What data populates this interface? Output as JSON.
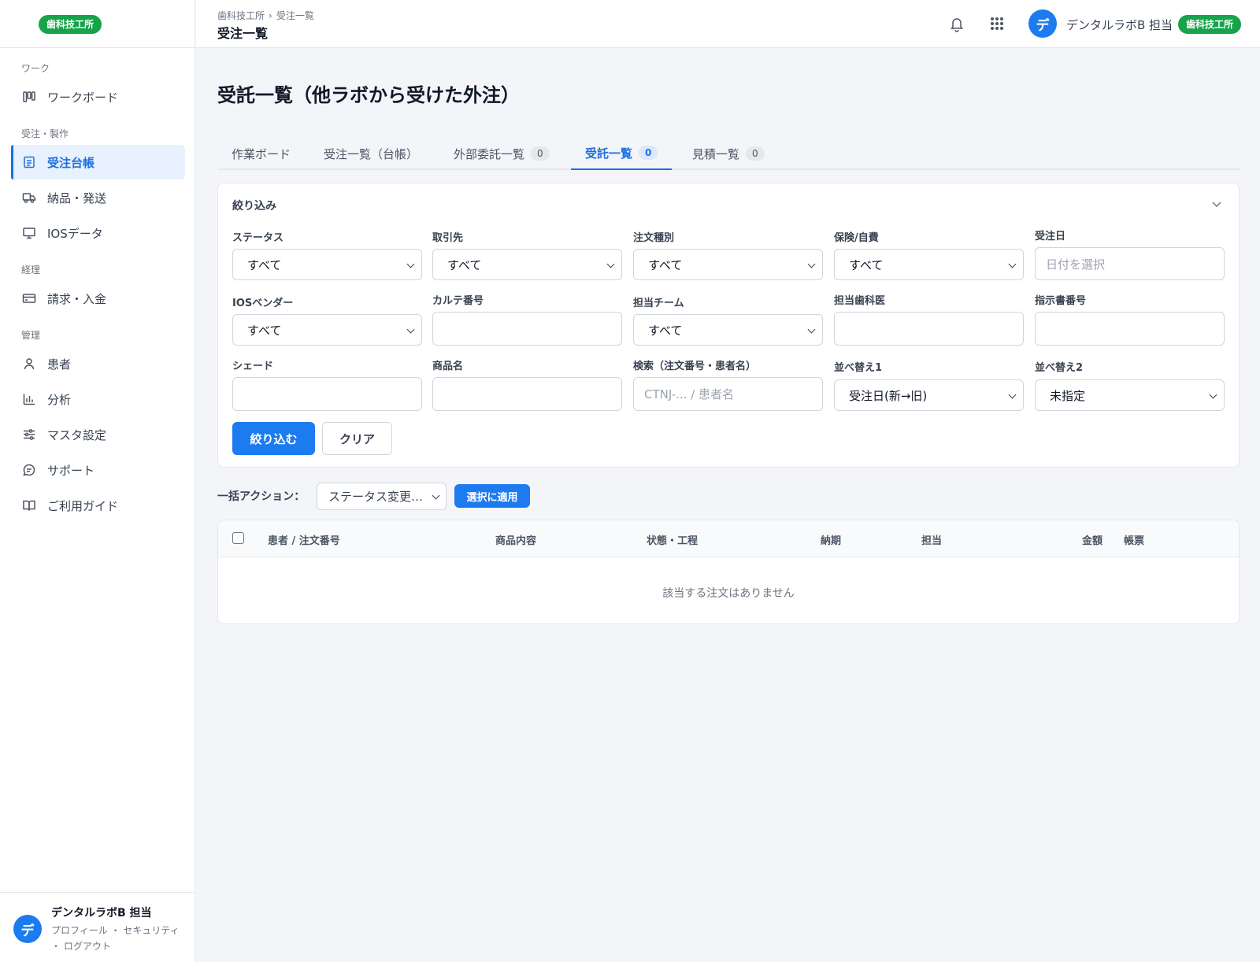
{
  "brand": {
    "badge": "歯科技工所"
  },
  "sidebar": {
    "sections": [
      {
        "title": "ワーク"
      },
      {
        "title": "受注・製作"
      },
      {
        "title": "経理"
      },
      {
        "title": "管理"
      }
    ],
    "items": [
      {
        "label": "ワークボード",
        "icon": "kanban-icon"
      },
      {
        "label": "受注台帳",
        "icon": "ledger-icon",
        "active": true
      },
      {
        "label": "納品・発送",
        "icon": "truck-icon"
      },
      {
        "label": "IOSデータ",
        "icon": "monitor-icon"
      },
      {
        "label": "請求・入金",
        "icon": "credit-card-icon"
      },
      {
        "label": "患者",
        "icon": "user-icon"
      },
      {
        "label": "分析",
        "icon": "bar-chart-icon"
      },
      {
        "label": "マスタ設定",
        "icon": "sliders-icon"
      },
      {
        "label": "サポート",
        "icon": "chat-icon"
      },
      {
        "label": "ご利用ガイド",
        "icon": "book-icon"
      }
    ],
    "footer": {
      "avatar": "デ",
      "name": "デンタルラボB 担当",
      "links_line1": "プロフィール ・ セキュリティ",
      "links_line2": "・ ログアウト"
    }
  },
  "header": {
    "breadcrumb": [
      "歯科技工所",
      "受注一覧"
    ],
    "breadcrumb_sep": "›",
    "title": "受注一覧",
    "avatar": "デ",
    "user": "デンタルラボB 担当",
    "badge": "歯科技工所"
  },
  "main": {
    "title": "受託一覧（他ラボから受けた外注）",
    "tabs": [
      {
        "label": "作業ボード"
      },
      {
        "label": "受注一覧（台帳）"
      },
      {
        "label": "外部委託一覧",
        "count": "0"
      },
      {
        "label": "受託一覧",
        "count": "0",
        "active": true
      },
      {
        "label": "見積一覧",
        "count": "0"
      }
    ],
    "filter": {
      "title": "絞り込み",
      "fields": [
        {
          "label": "ステータス",
          "value": "すべて",
          "type": "select"
        },
        {
          "label": "取引先",
          "value": "すべて",
          "type": "select"
        },
        {
          "label": "注文種別",
          "value": "すべて",
          "type": "select"
        },
        {
          "label": "保険/自費",
          "value": "すべて",
          "type": "select"
        },
        {
          "label": "受注日",
          "placeholder": "日付を選択",
          "type": "input"
        },
        {
          "label": "IOSベンダー",
          "value": "すべて",
          "type": "select"
        },
        {
          "label": "カルテ番号",
          "value": "",
          "type": "input"
        },
        {
          "label": "担当チーム",
          "value": "すべて",
          "type": "select"
        },
        {
          "label": "担当歯科医",
          "value": "",
          "type": "input"
        },
        {
          "label": "指示書番号",
          "value": "",
          "type": "input"
        },
        {
          "label": "シェード",
          "value": "",
          "type": "input"
        },
        {
          "label": "商品名",
          "value": "",
          "type": "input"
        },
        {
          "label": "検索（注文番号・患者名）",
          "placeholder": "CTNJ-... / 患者名",
          "type": "input"
        },
        {
          "label": "並べ替え1",
          "value": "受注日(新→旧)",
          "type": "select"
        },
        {
          "label": "並べ替え2",
          "value": "未指定",
          "type": "select"
        }
      ],
      "apply_label": "絞り込む",
      "clear_label": "クリア"
    },
    "bulk": {
      "label": "一括アクション：",
      "select_value": "ステータス変更…",
      "apply_label": "選択に適用"
    },
    "table": {
      "columns": [
        "患者 / 注文番号",
        "商品内容",
        "状態・工程",
        "納期",
        "担当",
        "金額",
        "帳票"
      ],
      "empty_text": "該当する注文はありません"
    }
  },
  "colors": {
    "accent": "#1d7bf0",
    "brand_badge": "#16a34a"
  }
}
